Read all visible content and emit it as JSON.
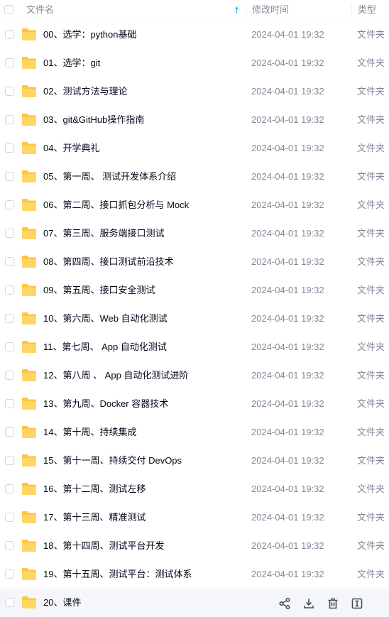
{
  "header": {
    "col_name": "文件名",
    "col_time": "修改时间",
    "col_type": "类型",
    "sort_icon": "sort-up-arrow-icon"
  },
  "folder_color": "#ffc53d",
  "accent_color": "#06a7ff",
  "rows": [
    {
      "name": "00、选学：python基础",
      "time": "2024-04-01 19:32",
      "type": "文件夹"
    },
    {
      "name": "01、选学：git",
      "time": "2024-04-01 19:32",
      "type": "文件夹"
    },
    {
      "name": "02、测试方法与理论",
      "time": "2024-04-01 19:32",
      "type": "文件夹"
    },
    {
      "name": "03、git&GitHub操作指南",
      "time": "2024-04-01 19:32",
      "type": "文件夹"
    },
    {
      "name": "04、开学典礼",
      "time": "2024-04-01 19:32",
      "type": "文件夹"
    },
    {
      "name": "05、第一周、 测试开发体系介绍",
      "time": "2024-04-01 19:32",
      "type": "文件夹"
    },
    {
      "name": "06、第二周、接口抓包分析与 Mock",
      "time": "2024-04-01 19:32",
      "type": "文件夹"
    },
    {
      "name": "07、第三周、服务端接口测试",
      "time": "2024-04-01 19:32",
      "type": "文件夹"
    },
    {
      "name": "08、第四周、接口测试前沿技术",
      "time": "2024-04-01 19:32",
      "type": "文件夹"
    },
    {
      "name": "09、第五周、接口安全测试",
      "time": "2024-04-01 19:32",
      "type": "文件夹"
    },
    {
      "name": "10、第六周、Web 自动化测试",
      "time": "2024-04-01 19:32",
      "type": "文件夹"
    },
    {
      "name": "11、第七周、 App 自动化测试",
      "time": "2024-04-01 19:32",
      "type": "文件夹"
    },
    {
      "name": "12、第八周 、 App 自动化测试进阶",
      "time": "2024-04-01 19:32",
      "type": "文件夹"
    },
    {
      "name": "13、第九周、Docker 容器技术",
      "time": "2024-04-01 19:32",
      "type": "文件夹"
    },
    {
      "name": "14、第十周、持续集成",
      "time": "2024-04-01 19:32",
      "type": "文件夹"
    },
    {
      "name": "15、第十一周、持续交付  DevOps",
      "time": "2024-04-01 19:32",
      "type": "文件夹"
    },
    {
      "name": "16、第十二周、测试左移",
      "time": "2024-04-01 19:32",
      "type": "文件夹"
    },
    {
      "name": "17、第十三周、精准测试",
      "time": "2024-04-01 19:32",
      "type": "文件夹"
    },
    {
      "name": "18、第十四周、测试平台开发",
      "time": "2024-04-01 19:32",
      "type": "文件夹"
    },
    {
      "name": "19、第十五周、测试平台：测试体系",
      "time": "2024-04-01 19:32",
      "type": "文件夹"
    },
    {
      "name": "20、课件",
      "hover": true,
      "actions": [
        "share-icon",
        "download-icon",
        "delete-icon",
        "rename-icon"
      ]
    }
  ]
}
